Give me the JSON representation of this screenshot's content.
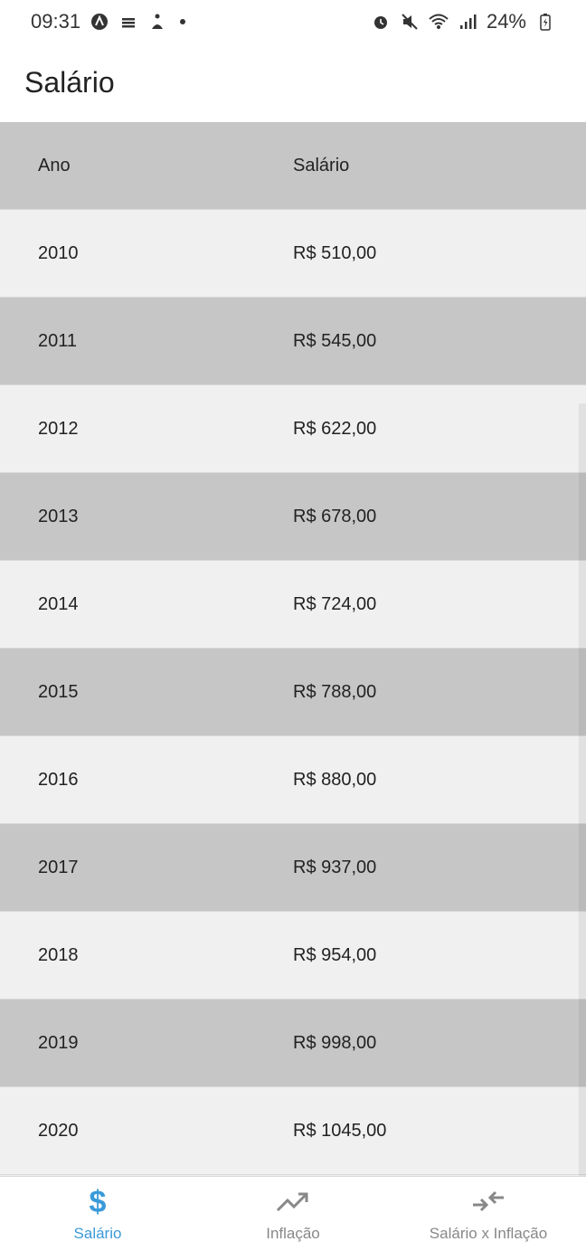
{
  "status_bar": {
    "time": "09:31",
    "battery": "24%"
  },
  "app_bar": {
    "title": "Salário"
  },
  "table": {
    "columns": [
      "Ano",
      "Salário"
    ],
    "rows": [
      {
        "year": "2010",
        "salary": "R$ 510,00"
      },
      {
        "year": "2011",
        "salary": "R$ 545,00"
      },
      {
        "year": "2012",
        "salary": "R$ 622,00"
      },
      {
        "year": "2013",
        "salary": "R$ 678,00"
      },
      {
        "year": "2014",
        "salary": "R$ 724,00"
      },
      {
        "year": "2015",
        "salary": "R$ 788,00"
      },
      {
        "year": "2016",
        "salary": "R$ 880,00"
      },
      {
        "year": "2017",
        "salary": "R$ 937,00"
      },
      {
        "year": "2018",
        "salary": "R$ 954,00"
      },
      {
        "year": "2019",
        "salary": "R$ 998,00"
      },
      {
        "year": "2020",
        "salary": "R$ 1045,00"
      }
    ]
  },
  "bottom_nav": {
    "items": [
      {
        "label": "Salário",
        "icon": "dollar-icon",
        "active": true
      },
      {
        "label": "Inflação",
        "icon": "trending-up-icon",
        "active": false
      },
      {
        "label": "Salário x Inflação",
        "icon": "compare-arrows-icon",
        "active": false
      }
    ],
    "dollar_symbol": "$"
  },
  "colors": {
    "active": "#3a9ad9",
    "inactive": "#888888",
    "row_dark": "#c6c6c6",
    "row_light": "#f0f0f0"
  }
}
